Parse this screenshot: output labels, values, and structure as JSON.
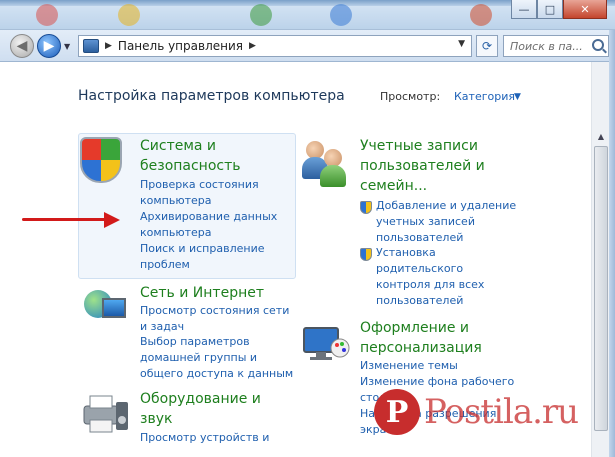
{
  "window": {
    "caption_buttons": {
      "minimize": "—",
      "maximize": "□",
      "close": "✕"
    }
  },
  "navbar": {
    "address_path": "Панель управления",
    "search_placeholder": "Поиск в па..."
  },
  "header": {
    "title": "Настройка параметров компьютера",
    "view_label": "Просмотр:",
    "view_value": "Категория"
  },
  "categories": [
    {
      "title_line1": "Система и",
      "title_line2": "безопасность",
      "links": [
        {
          "line1": "Проверка состояния",
          "line2": "компьютера"
        },
        {
          "line1": "Архивирование данных",
          "line2": "компьютера"
        },
        {
          "line1": "Поиск и исправление",
          "line2": "проблем"
        }
      ]
    },
    {
      "title_line1": "Учетные записи",
      "title_line2": "пользователей и",
      "title_line3": "семейн...",
      "links": [
        {
          "line1": "Добавление и удаление",
          "line2": "учетных записей",
          "line3": "пользователей"
        },
        {
          "line1": "Установка",
          "line2": "родительского",
          "line3": "контроля для всех",
          "line4": "пользователей"
        }
      ]
    },
    {
      "title_line1": "Сеть и Интернет",
      "links": [
        {
          "line1": "Просмотр состояния сети",
          "line2": "и задач"
        },
        {
          "line1": "Выбор параметров",
          "line2": "домашней группы и",
          "line3": "общего доступа к данным"
        }
      ]
    },
    {
      "title_line1": "Оформление и",
      "title_line2": "персонализация",
      "links": [
        {
          "line1": "Изменение темы"
        },
        {
          "line1": "Изменение фона рабочего",
          "line2": "стола"
        },
        {
          "line1": "Настройка разрешения",
          "line2": "экрана"
        }
      ]
    },
    {
      "title_line1": "Оборудование и",
      "title_line2": "звук",
      "links": [
        {
          "line1": "Просмотр устройств и"
        }
      ]
    }
  ],
  "watermark": {
    "logo": "P",
    "text": "Postila.ru"
  },
  "colors": {
    "category_title": "#1e7f1e",
    "link": "#1f5fae",
    "annotation_arrow": "#d21a1a"
  }
}
